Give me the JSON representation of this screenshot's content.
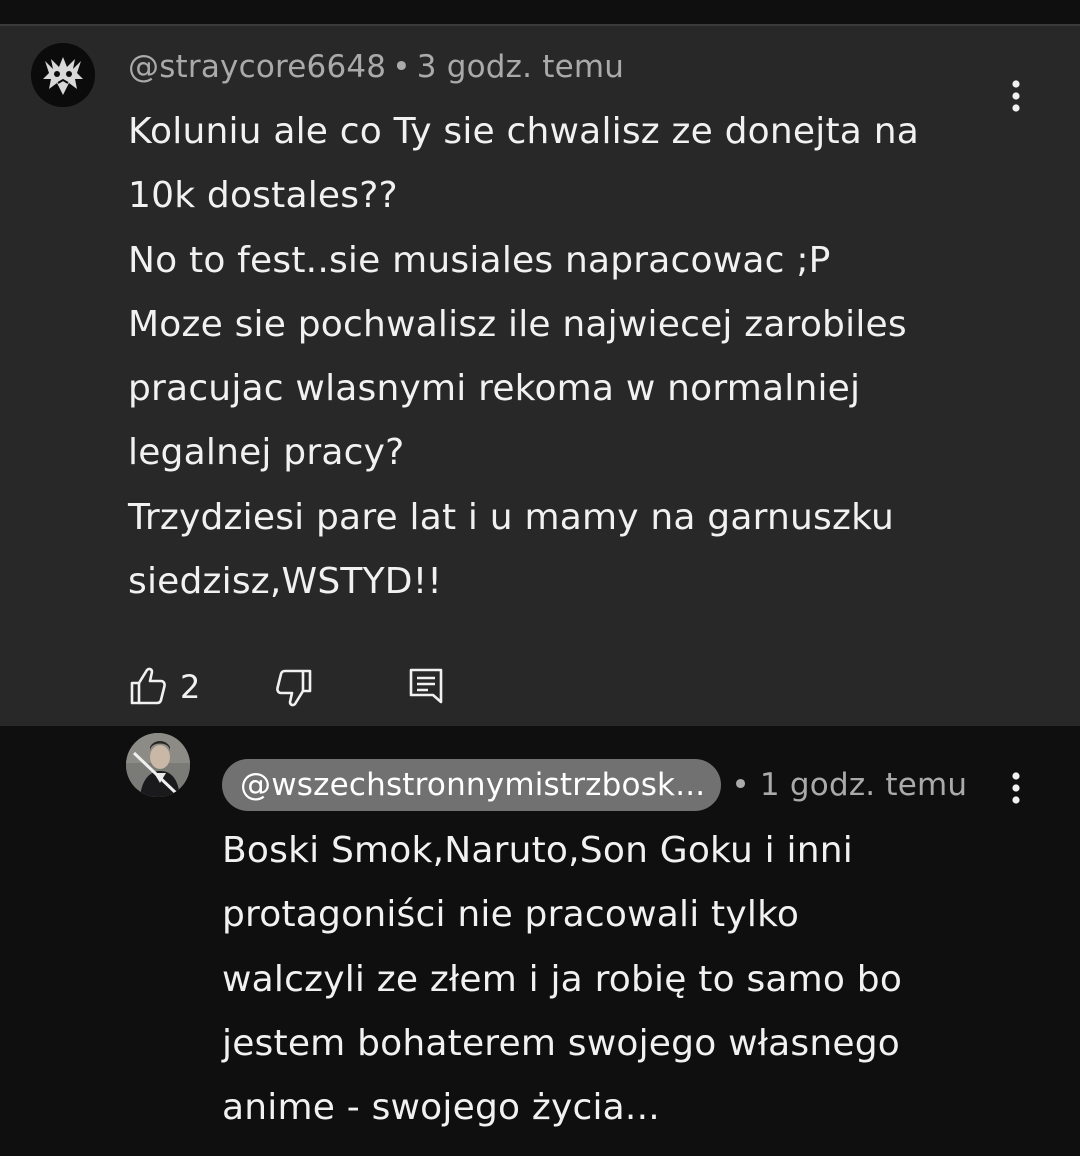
{
  "comment": {
    "author": "@straycore6648",
    "separator": "•",
    "time": "3 godz. temu",
    "lines": [
      "Koluniu ale co Ty sie chwalisz ze donejta na",
      "10k dostales??",
      "No to fest..sie musiales napracowac ;P",
      "Moze sie pochwalisz ile najwiecej zarobiles",
      "pracujac wlasnymi rekoma w normalniej",
      "legalnej pracy?",
      "Trzydziesi pare lat i u mamy na garnuszku",
      "siedzisz,WSTYD!!"
    ],
    "like_count": "2",
    "icons": {
      "like": "thumbs-up-icon",
      "dislike": "thumbs-down-icon",
      "reply": "reply-comment-icon",
      "menu": "more-vert-icon"
    }
  },
  "reply": {
    "author": "@wszechstronnymistrzbosk...",
    "separator": "•",
    "time": "1 godz. temu",
    "lines": [
      "Boski Smok,Naruto,Son Goku i inni",
      "protagoniści nie pracowali tylko",
      "walczyli ze złem i ja robię to samo bo",
      "jestem bohaterem swojego własnego",
      "anime - swojego życia..."
    ],
    "icons": {
      "menu": "more-vert-icon"
    }
  },
  "colors": {
    "background": "#0f0f0f",
    "comment_highlight": "#282828",
    "text_primary": "#f1f1f1",
    "text_secondary": "#aaaaaa",
    "handle_pill": "#717171"
  }
}
